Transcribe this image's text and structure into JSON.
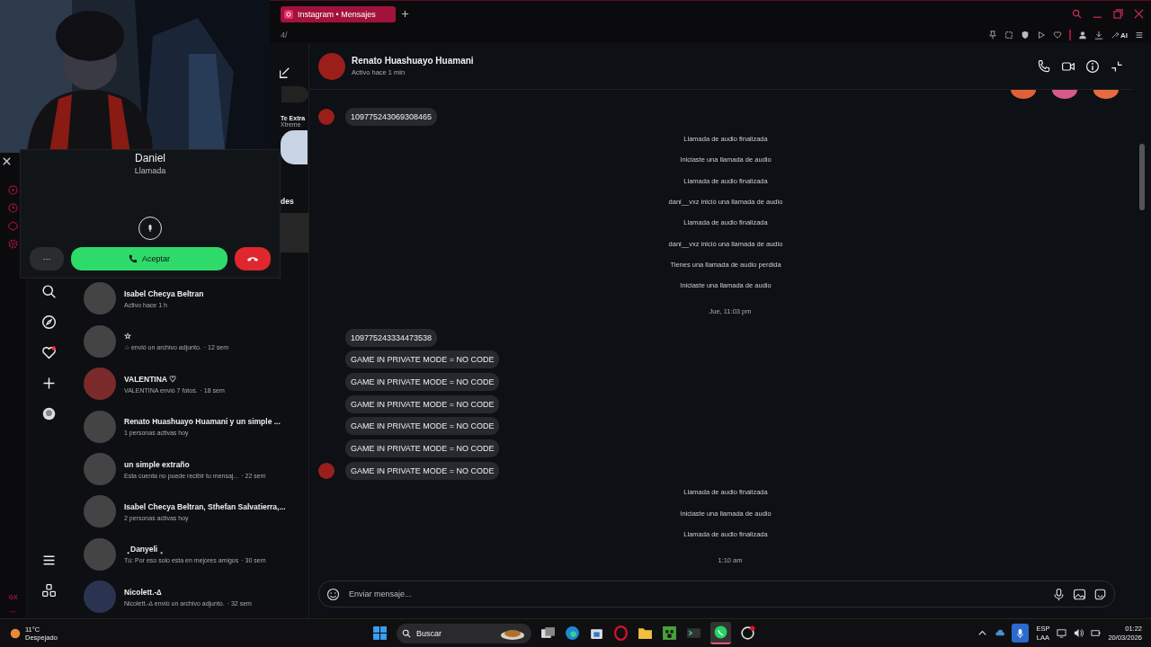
{
  "browser": {
    "tabs": [
      {
        "label": "Instagram • Mensajes",
        "selected": true
      }
    ],
    "address": "4/",
    "toolbar_ai": "AI"
  },
  "call": {
    "caller": "Daniel",
    "status": "Llamada",
    "more": "···",
    "accept": "Aceptar"
  },
  "gx_sidebar": {
    "bottom_label": "GX",
    "more": "···"
  },
  "inbox": {
    "story_title": "Te Extra",
    "story_subtitle": "Xtreme",
    "requests_label": "des",
    "conversations": [
      {
        "name": "Isabel Checya Beltran",
        "preview": "Activo hace 1 h"
      },
      {
        "name": "☆",
        "preview": "☆ envió un archivo adjunto.",
        "time": "· 12 sem"
      },
      {
        "name": "VALENTINA ♡",
        "preview": "VALENTINA envió 7 fotos.",
        "time": "· 18 sem"
      },
      {
        "name": "Renato Huashuayo Huamani y un simple ...",
        "preview": "1 personas activas hoy"
      },
      {
        "name": "un simple extraño",
        "preview": "Esta cuenta no puede recibir tu mensaj...",
        "time": "· 22 sem"
      },
      {
        "name": "Isabel Checya Beltran, Sthefan Salvatierra,...",
        "preview": "2 personas activas hoy"
      },
      {
        "name": "⢀Danyeli⢀",
        "preview": "Tú: Por eso solo esta en mejores amigos",
        "time": "· 30 sem"
      },
      {
        "name": "Nicolett.-∆",
        "preview": "Nicolett.-∆ envió un archivo adjunto.",
        "time": "· 32 sem"
      }
    ]
  },
  "chat": {
    "name": "Renato Huashuayo Huamani",
    "status": "Activo hace 1 min",
    "placeholder": "Enviar mensaje...",
    "messages": [
      {
        "kind": "received",
        "text": "109775243069308465",
        "avatar": true
      },
      {
        "kind": "system",
        "text": "Llamada de audio finalizada"
      },
      {
        "kind": "system",
        "text": "Iniciaste una llamada de audio"
      },
      {
        "kind": "system",
        "text": "Llamada de audio finalizada"
      },
      {
        "kind": "system",
        "text": "dani__vxz inició una llamada de audio"
      },
      {
        "kind": "system",
        "text": "Llamada de audio finalizada"
      },
      {
        "kind": "system",
        "text": "dani__vxz inició una llamada de audio"
      },
      {
        "kind": "system",
        "text": "Tienes una llamada de audio perdida"
      },
      {
        "kind": "system",
        "text": "Iniciaste una llamada de audio"
      },
      {
        "kind": "time",
        "text": "Jue, 11:03 pm"
      },
      {
        "kind": "received",
        "text": "109775243334473538",
        "avatar": false
      },
      {
        "kind": "received",
        "text": "GAME IN PRIVATE MODE = NO CODE",
        "avatar": false
      },
      {
        "kind": "received",
        "text": "GAME IN PRIVATE MODE = NO CODE",
        "avatar": false
      },
      {
        "kind": "received",
        "text": "GAME IN PRIVATE MODE = NO CODE",
        "avatar": false
      },
      {
        "kind": "received",
        "text": "GAME IN PRIVATE MODE = NO CODE",
        "avatar": false
      },
      {
        "kind": "received",
        "text": "GAME IN PRIVATE MODE = NO CODE",
        "avatar": false
      },
      {
        "kind": "received",
        "text": "GAME IN PRIVATE MODE = NO CODE",
        "avatar": true
      },
      {
        "kind": "system",
        "text": "Llamada de audio finalizada"
      },
      {
        "kind": "system",
        "text": "Iniciaste una llamada de audio"
      },
      {
        "kind": "system",
        "text": "Llamada de audio finalizada"
      },
      {
        "kind": "time",
        "text": "1:10 am"
      }
    ]
  },
  "taskbar": {
    "temperature": "11°C",
    "weather": "Despejado",
    "search": "Buscar",
    "lang": "ESP",
    "layout": "LAA",
    "time": "01:22",
    "date": "20/03/2026"
  }
}
